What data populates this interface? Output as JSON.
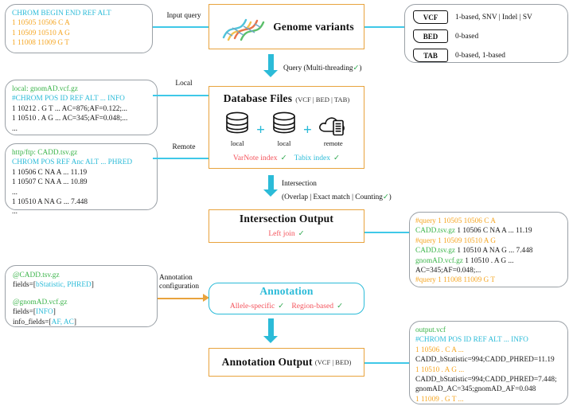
{
  "input_query_box": {
    "header": "CHROM  BEGIN  END  REF  ALT",
    "rows": [
      "1  10505  10506  C  A",
      "1  10509  10510  A  G",
      "1  11008  11009  G  T"
    ]
  },
  "edges": {
    "input_query": "Input query",
    "local": "Local",
    "remote": "Remote",
    "annotation_configuration_line1": "Annotation",
    "annotation_configuration_line2": "configuration",
    "query_label": "Query (",
    "query_highlight": "Multi-threading",
    "query_check": "✓",
    "query_close": ")",
    "intersection_label": "Intersection",
    "intersection_modes": "(Overlap | Exact match | Counting",
    "intersection_check": "✓",
    "intersection_close": ")"
  },
  "genome_variants": {
    "title": "Genome variants",
    "icon": "dna-helix-icon"
  },
  "formats_box": {
    "items": [
      {
        "chip": "VCF",
        "desc": "1-based, SNV | Indel | SV"
      },
      {
        "chip": "BED",
        "desc": "0-based"
      },
      {
        "chip": "TAB",
        "desc": "0-based, 1-based"
      }
    ]
  },
  "gnomad_box": {
    "filename": "local: gnomAD.vcf.gz",
    "header": "#CHROM  POS  ID  REF  ALT  ...  INFO",
    "rows": [
      "1  10212  .  G  T  ...  AC=876;AF=0.122;...",
      "1  10510  .  A  G  ...  AC=345;AF=0.048;...",
      "..."
    ]
  },
  "cadd_box": {
    "filename": "http/ftp: CADD.tsv.gz",
    "header": "CHROM  POS  REF  Anc  ALT  ...  PHRED",
    "rows": [
      "1  10506  C  NA  A  ...  11.19",
      "1  10507  C  NA  A  ...  10.89",
      "...",
      "1  10510  A  NA  G  ...  7.448",
      "..."
    ]
  },
  "database_files": {
    "title": "Database Files",
    "subtitle": "(VCF | BED | TAB)",
    "sources": [
      {
        "icon": "database-cylinder-icon",
        "label": "local"
      },
      {
        "icon": "database-cylinder-icon",
        "label": "local"
      },
      {
        "icon": "cloud-server-icon",
        "label": "remote"
      }
    ],
    "plus": "+",
    "index_varnote": "VarNote index",
    "index_varnote_check": "✓",
    "index_tabix": "Tabix index",
    "index_tabix_check": "✓"
  },
  "intersection_output": {
    "title": "Intersection Output",
    "subtitle": "Left join",
    "check": "✓"
  },
  "intersection_result_box": {
    "lines": [
      {
        "color": "orange",
        "text": "#query  1  10505  10506  C  A"
      },
      {
        "color": "green_dark",
        "prefix": "CADD.tsv.gz",
        "text": "  1  10506  C  NA  A  ...  11.19"
      },
      {
        "color": "orange",
        "text": "#query  1  10509  10510  A  G"
      },
      {
        "color": "green_dark",
        "prefix": "CADD.tsv.gz",
        "text": "  1  10510  A  NA  G  ...  7.448"
      },
      {
        "color": "green_dark",
        "prefix": "gnomAD.vcf.gz",
        "text": "  1  10510  .  A  G  ..."
      },
      {
        "color": "dark",
        "text": "AC=345;AF=0.048;..."
      },
      {
        "color": "orange",
        "text": "#query  1  11008  11009  G  T"
      }
    ]
  },
  "annotation_config_box": {
    "groups": [
      {
        "file": "@CADD.tsv.gz",
        "lines": [
          {
            "label": "fields=[",
            "value": "bStatistic, PHRED",
            "close": "]"
          }
        ]
      },
      {
        "file": "@gnomAD.vcf.gz",
        "lines": [
          {
            "label": "fields=[",
            "value": "INFO",
            "close": "]"
          },
          {
            "label": "info_fields=[",
            "value": "AF, AC",
            "close": "]"
          }
        ]
      }
    ]
  },
  "annotation": {
    "title": "Annotation",
    "mode_allele": "Allele-specific",
    "mode_allele_check": "✓",
    "mode_region": "Region-based",
    "mode_region_check": "✓"
  },
  "annotation_output": {
    "title": "Annotation Output",
    "subtitle": "(VCF | BED)"
  },
  "output_vcf_box": {
    "filename": "output.vcf",
    "header": "#CHROM  POS ID  REF  ALT  ...  INFO",
    "lines": [
      {
        "color": "orange",
        "text": "1  10506  .  C  A  ..."
      },
      {
        "color": "dark",
        "text": "CADD_bStatistic=994;CADD_PHRED=11.19"
      },
      {
        "color": "orange",
        "text": "1  10510  .  A  G  ..."
      },
      {
        "color": "dark",
        "text": "CADD_bStatistic=994;CADD_PHRED=7.448;"
      },
      {
        "color": "dark",
        "text": "gnomAD_AC=345;gnomAD_AF=0.048"
      },
      {
        "color": "orange",
        "text": "1  11009  .  G  T  ..."
      }
    ]
  },
  "colors": {
    "cyan": "#2BBBD8",
    "orange_border": "#E8A33D",
    "orange_text": "#F5A623",
    "green": "#3BB44A",
    "red": "#F4525B",
    "check_green": "#2EA84F"
  }
}
